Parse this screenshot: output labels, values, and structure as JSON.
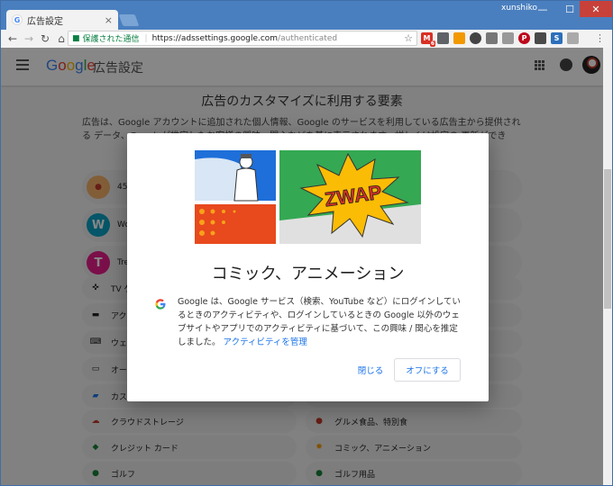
{
  "browser": {
    "tab_title": "広告設定",
    "tab_close": "×",
    "username": "xunshiko",
    "window_controls": [
      "—",
      "☐",
      "✕"
    ],
    "secure_label": "保護された通信",
    "url_host": "https://adssettings.google.com",
    "url_path": "/authenticated",
    "ext_badge": "6"
  },
  "appbar": {
    "logo_letters": [
      "G",
      "o",
      "o",
      "g",
      "l",
      "e"
    ],
    "product": "広告設定"
  },
  "main": {
    "section_title": "広告のカスタマイズに利用する要素",
    "description": "広告は、Google アカウントに追加された個人情報、Google のサービスを利用している広告主から提供される データ、Googleが推定したお客様の興味・関心などを基に表示されます。詳しくは設定の 更新ができ",
    "chips_left": [
      {
        "label": "45",
        "icon": "cake-icon"
      },
      {
        "label": "Wo",
        "icon": "W",
        "color": "#0aa3c4"
      },
      {
        "label": "Tre",
        "icon": "T",
        "color": "#e91e8c"
      },
      {
        "label": "TV ゲ",
        "icon": "gamepad-icon"
      },
      {
        "label": "アクシ",
        "icon": "film-icon"
      },
      {
        "label": "ウェブ",
        "icon": "keyboard-icon"
      },
      {
        "label": "オー",
        "icon": "laptop-icon"
      },
      {
        "label": "カスタ",
        "icon": "car-icon"
      },
      {
        "label": "クラウドストレージ",
        "icon": "cloud-icon"
      },
      {
        "label": "クレジット カード",
        "icon": "card-icon"
      },
      {
        "label": "ゴルフ",
        "icon": "golf-icon"
      }
    ],
    "chips_right": [
      {
        "label": "グルメ食品、特別食",
        "icon": "food-icon"
      },
      {
        "label": "コミック、アニメーション",
        "icon": "burst-icon"
      },
      {
        "label": "ゴルフ用品",
        "icon": "golf-icon"
      }
    ]
  },
  "dialog": {
    "illustration_text": "ZWAP",
    "title": "コミック、アニメーション",
    "body": "Google は、Google サービス（検索、YouTube など）にログインしているときのアクティビティや、ログインしているときの Google 以外のウェブサイトやアプリでのアクティビティに基づいて、この興味 / 関心を推定しました。",
    "link": "アクティビティを管理",
    "close_button": "閉じる",
    "off_button": "オフにする"
  },
  "colors": {
    "accent": "#1a73e8",
    "titlebar": "#4a7fbf",
    "secure": "#0b8043"
  }
}
